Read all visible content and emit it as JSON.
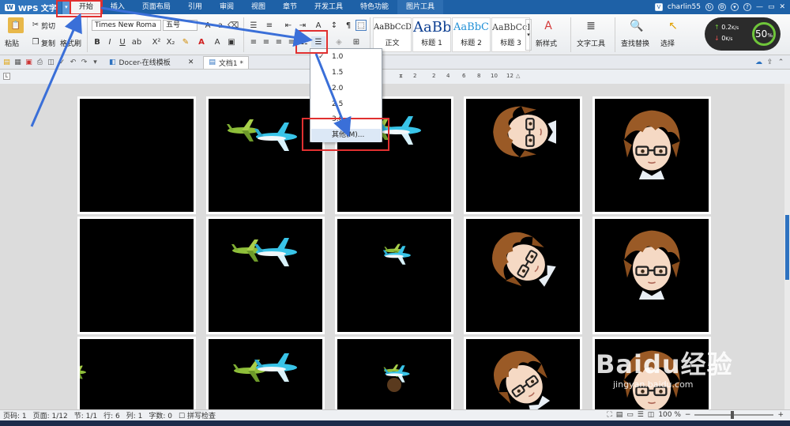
{
  "app": {
    "name": "WPS 文字",
    "logo": "W",
    "dropdown_icon": "triangle-down"
  },
  "menu": {
    "tabs": [
      "开始",
      "插入",
      "页面布局",
      "引用",
      "审阅",
      "视图",
      "章节",
      "开发工具",
      "特色功能",
      "图片工具"
    ],
    "active": "开始"
  },
  "user": {
    "name": "charlin55",
    "badge": "V"
  },
  "ribbon": {
    "paste": "粘贴",
    "cut": "剪切",
    "copy": "复制",
    "format_painter": "格式刷",
    "font_name": "Times New Roma",
    "font_size": "五号",
    "bold": "B",
    "italic": "I",
    "underline": "U",
    "superscript": "X²",
    "subscript": "X₂",
    "styles": [
      {
        "sample": "AaBbCcDd",
        "label": "正文",
        "color": "#222222"
      },
      {
        "sample": "AaBb",
        "label": "标题 1",
        "color": "#0a3d91"
      },
      {
        "sample": "AaBbC",
        "label": "标题 2",
        "color": "#1f8fd6"
      },
      {
        "sample": "AaBbCcI",
        "label": "标题 3",
        "color": "#444444"
      }
    ],
    "new_style": "新样式",
    "text_tools": "文字工具",
    "find_replace": "查找替换",
    "select": "选择"
  },
  "speed": {
    "up": "0.2",
    "down": "0",
    "unit": "K/s",
    "percent": "50",
    "percent_sign": "%"
  },
  "tabs": {
    "docer": "Docer-在线模板",
    "doc": "文档1 *"
  },
  "ruler": {
    "marks": [
      "2",
      "2",
      "4",
      "6",
      "8",
      "10",
      "12"
    ]
  },
  "line_spacing_menu": {
    "items": [
      "1.0",
      "1.5",
      "2.0",
      "2.5",
      "3.0",
      "其他(M)..."
    ],
    "checked": "1.0",
    "highlighted": "其他(M)..."
  },
  "status": {
    "page_num": "页码: 1",
    "pages": "页面: 1/12",
    "section": "节: 1/1",
    "row": "行: 6",
    "col": "列: 1",
    "words": "字数: 0",
    "spellcheck": "拼写检查",
    "zoom": "100 %"
  },
  "watermark": {
    "text": "Baidu经验",
    "url": "jingyan.baidu.com"
  },
  "colors": {
    "titlebar": "#1e61a7",
    "highlight": "#e03030",
    "annotation": "#3a6fd8",
    "speed_ring": "#6fc53a"
  }
}
